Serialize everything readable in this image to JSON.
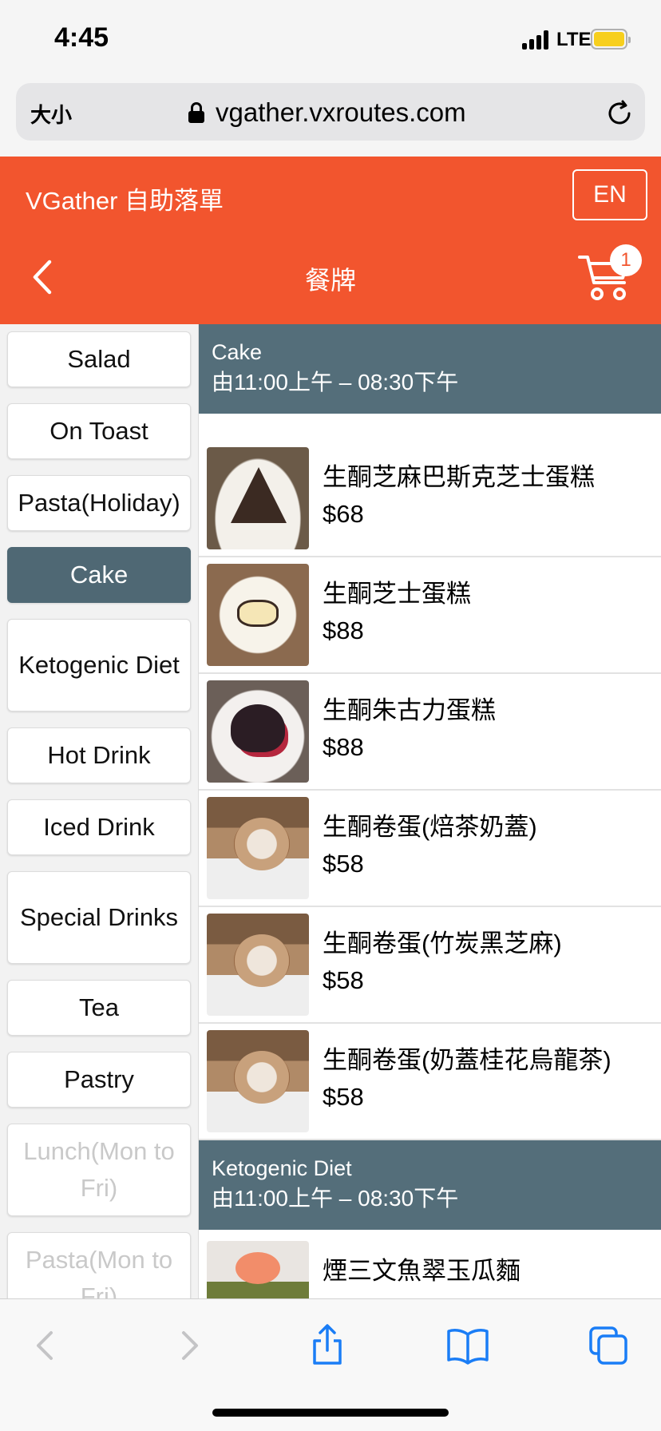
{
  "status_bar": {
    "time": "4:45",
    "network": "LTE"
  },
  "browser": {
    "text_size_label": "大小",
    "url": "vgather.vxroutes.com"
  },
  "header": {
    "brand": "VGather 自助落單",
    "lang_button": "EN",
    "title": "餐牌",
    "cart_count": "1"
  },
  "categories": [
    {
      "label": "Salad",
      "state": "normal"
    },
    {
      "label": "On Toast",
      "state": "normal"
    },
    {
      "label": "Pasta(Holiday)",
      "state": "normal"
    },
    {
      "label": "Cake",
      "state": "active"
    },
    {
      "label": "Ketogenic Diet",
      "state": "normal"
    },
    {
      "label": "Hot Drink",
      "state": "normal"
    },
    {
      "label": "Iced Drink",
      "state": "normal"
    },
    {
      "label": "Special Drinks",
      "state": "normal"
    },
    {
      "label": "Tea",
      "state": "normal"
    },
    {
      "label": "Pastry",
      "state": "normal"
    },
    {
      "label": "Lunch(Mon to Fri)",
      "state": "disabled"
    },
    {
      "label": "Pasta(Mon to Fri)",
      "state": "disabled"
    }
  ],
  "sections": [
    {
      "name": "Cake",
      "hours": "由11:00上午 – 08:30下午",
      "items": [
        {
          "name": "生酮芝麻巴斯克芝士蛋糕",
          "price": "$68",
          "image": "basque-cake-photo"
        },
        {
          "name": "生酮芝士蛋糕",
          "price": "$88",
          "image": "cheesecake-photo"
        },
        {
          "name": "生酮朱古力蛋糕",
          "price": "$88",
          "image": "chocolate-cake-photo"
        },
        {
          "name": "生酮卷蛋(焙茶奶蓋)",
          "price": "$58",
          "image": "swiss-roll-photo"
        },
        {
          "name": "生酮卷蛋(竹炭黑芝麻)",
          "price": "$58",
          "image": "swiss-roll-photo"
        },
        {
          "name": "生酮卷蛋(奶蓋桂花烏龍茶)",
          "price": "$58",
          "image": "swiss-roll-photo"
        }
      ]
    },
    {
      "name": "Ketogenic Diet",
      "hours": "由11:00上午 – 08:30下午",
      "items": [
        {
          "name": "煙三文魚翠玉瓜麵",
          "price": "",
          "image": "salmon-zucchini-noodle-photo"
        }
      ]
    }
  ],
  "colors": {
    "brand_orange": "#f2552e",
    "section_header": "#546e7a",
    "active_category": "#4f6874"
  }
}
